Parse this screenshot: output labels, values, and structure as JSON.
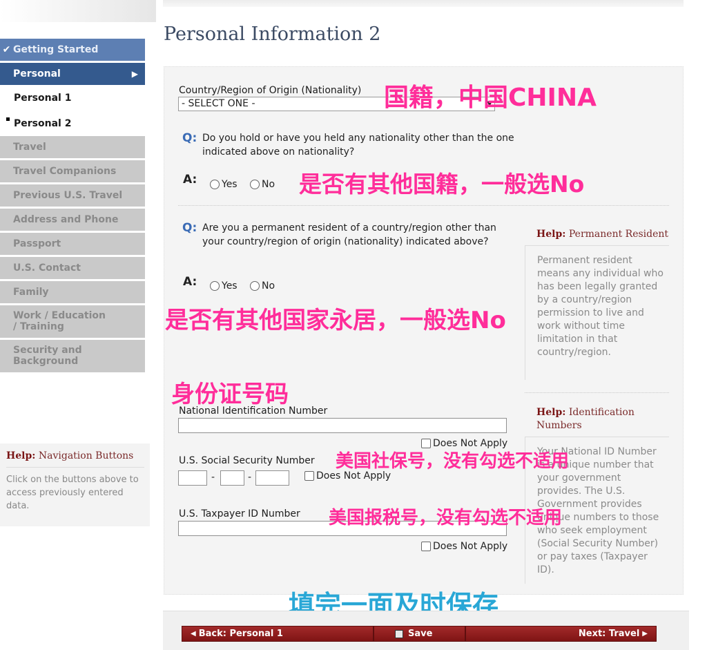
{
  "sidebar": {
    "items": [
      {
        "label": "Getting Started"
      },
      {
        "label": "Personal"
      },
      {
        "label": "Personal 1"
      },
      {
        "label": "Personal 2"
      },
      {
        "label": "Travel"
      },
      {
        "label": "Travel Companions"
      },
      {
        "label": "Previous U.S. Travel"
      },
      {
        "label": "Address and Phone"
      },
      {
        "label": "Passport"
      },
      {
        "label": "U.S. Contact"
      },
      {
        "label": "Family"
      },
      {
        "label": "Work / Education / Training"
      },
      {
        "label": "Security and Background"
      }
    ],
    "help": {
      "prefix": "Help:",
      "title": "Navigation Buttons",
      "body": "Click on the buttons above to access previously entered data."
    }
  },
  "page": {
    "title": "Personal Information 2"
  },
  "form": {
    "nationality": {
      "label": "Country/Region of Origin (Nationality)",
      "value": "- SELECT ONE -"
    },
    "q_prefix": "Q:",
    "a_prefix": "A:",
    "q1": {
      "text": "Do you hold or have you held any nationality other than the one indicated above on nationality?"
    },
    "q2": {
      "text": "Are you a permanent resident of a country/region other than your country/region of origin (nationality) indicated above?"
    },
    "yes": "Yes",
    "no": "No",
    "national_id": {
      "label": "National Identification Number"
    },
    "ssn": {
      "label": "U.S. Social Security Number"
    },
    "taxpayer": {
      "label": "U.S. Taxpayer ID Number"
    },
    "does_not_apply": "Does Not Apply",
    "dash": "-"
  },
  "help": {
    "permanent_resident": {
      "prefix": "Help:",
      "title": "Permanent Resident",
      "body": "Permanent resident means any individual who has been legally granted by a country/region permission to live and work without time limitation in that country/region."
    },
    "identification": {
      "prefix": "Help:",
      "title": "Identification Numbers",
      "body": "Your National ID Number is a unique number that your government provides. The U.S. Government provides unique numbers to those who seek employment (Social Security Number) or pay taxes (Taxpayer ID)."
    }
  },
  "annotations": {
    "nationality": "国籍，中国CHINA",
    "other_nationality": "是否有其他国籍，一般选No",
    "permanent_resident": "是否有其他国家永居，一般选No",
    "id_number": "身份证号码",
    "ssn": "美国社保号，没有勾选不适用",
    "tax": "美国报税号，没有勾选不适用",
    "save": "填完一面及时保存"
  },
  "buttons": {
    "back": "Back: Personal 1",
    "save": "Save",
    "next": "Next: Travel"
  },
  "colors": {
    "nav_active": "#345a8e",
    "nav_header": "#5d7fb3",
    "nav_disabled": "#c9c9c9",
    "button_red": "#8f1d1d",
    "annotation_pink": "#ff2d9a",
    "annotation_blue": "#29a7d6"
  }
}
